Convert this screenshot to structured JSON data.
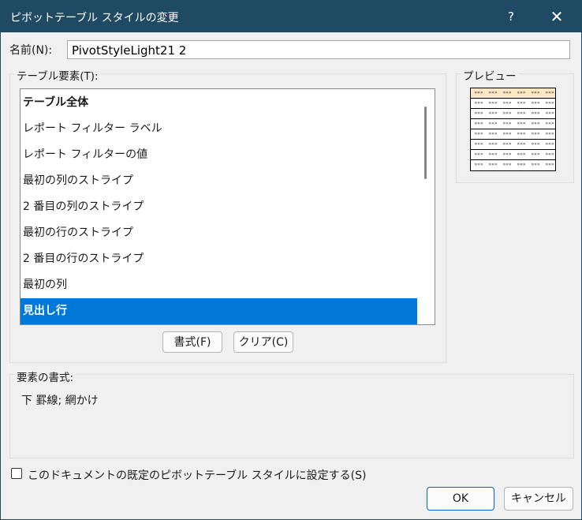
{
  "window": {
    "title": "ピボットテーブル スタイルの変更",
    "help": "?",
    "close": "✕"
  },
  "name": {
    "label": "名前(N):",
    "value": "PivotStyleLight21 2"
  },
  "table_elements": {
    "label": "テーブル要素(T):",
    "items": [
      {
        "label": "テーブル全体",
        "bold": true,
        "selected": false
      },
      {
        "label": "レポート フィルター ラベル",
        "bold": false,
        "selected": false
      },
      {
        "label": "レポート フィルターの値",
        "bold": false,
        "selected": false
      },
      {
        "label": "最初の列のストライプ",
        "bold": false,
        "selected": false
      },
      {
        "label": "2 番目の列のストライプ",
        "bold": false,
        "selected": false
      },
      {
        "label": "最初の行のストライプ",
        "bold": false,
        "selected": false
      },
      {
        "label": "2 番目の行のストライプ",
        "bold": false,
        "selected": false
      },
      {
        "label": "最初の列",
        "bold": false,
        "selected": false
      },
      {
        "label": "見出し行",
        "bold": true,
        "selected": true
      }
    ],
    "format_button": "書式(F)",
    "clear_button": "クリア(C)"
  },
  "preview": {
    "label": "プレビュー",
    "cell_text": "»»»"
  },
  "element_format": {
    "label": "要素の書式:",
    "value": "下 罫線; 網かけ"
  },
  "default_checkbox": {
    "label": "このドキュメントの既定のピボットテーブル スタイルに設定する(S)",
    "checked": false
  },
  "buttons": {
    "ok": "OK",
    "cancel": "キャンセル"
  },
  "colors": {
    "titlebar": "#1f4a63",
    "selection": "#0078d7",
    "preview_header": "#fde6c4"
  }
}
